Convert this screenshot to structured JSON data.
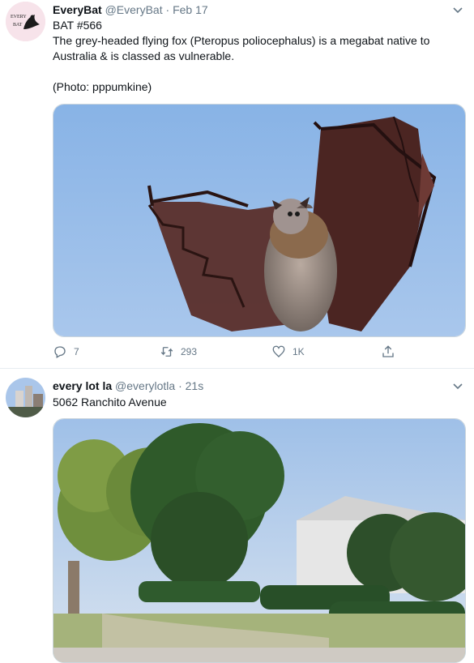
{
  "tweets": [
    {
      "name": "EveryBat",
      "handle": "@EveryBat",
      "sep": "·",
      "time": "Feb 17",
      "avatar_text_1": "EVERY",
      "avatar_text_2": "BAT",
      "line1": "BAT #566",
      "line2": "The grey-headed flying fox (Pteropus poliocephalus) is a megabat native to Australia & is classed as vulnerable.",
      "line3": "(Photo: pppumkine)",
      "replies": "",
      "replies_count": "7",
      "retweets": "293",
      "likes": "1K",
      "media_desc": "bat-photo"
    },
    {
      "name": "every lot la",
      "handle": "@everylotla",
      "sep": "·",
      "time": "21s",
      "line1": "5062 Ranchito Avenue",
      "media_desc": "street-photo"
    }
  ],
  "colors": {
    "accent": "#1da1f2",
    "muted": "#657786",
    "sky": "#8fb6e6",
    "border": "#e6ecf0"
  }
}
